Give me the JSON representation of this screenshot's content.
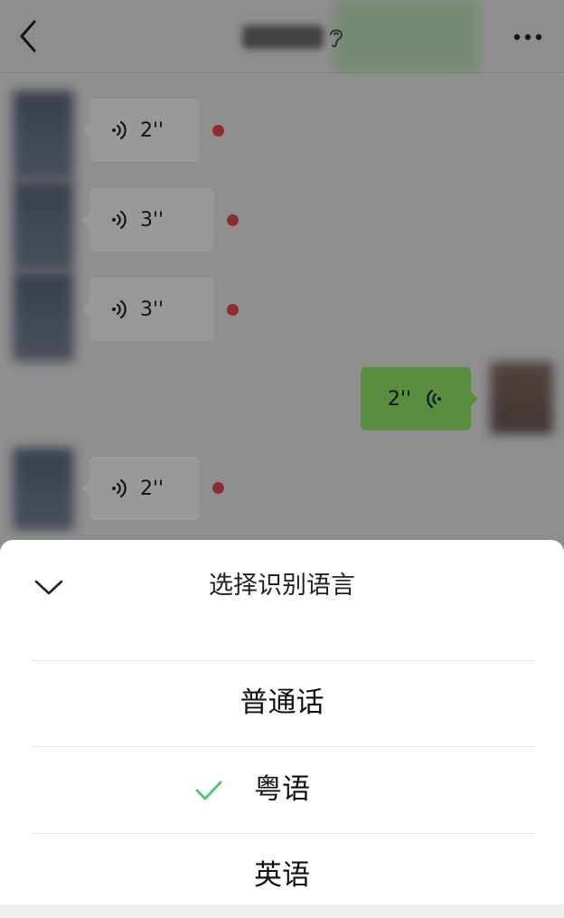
{
  "chat": {
    "messages": [
      {
        "direction": "incoming",
        "duration": "2''",
        "unread": true
      },
      {
        "direction": "incoming",
        "duration": "3''",
        "unread": true
      },
      {
        "direction": "incoming",
        "duration": "3''",
        "unread": true
      },
      {
        "direction": "outgoing",
        "duration": "2''",
        "unread": false
      },
      {
        "direction": "incoming",
        "duration": "2''",
        "unread": true
      }
    ]
  },
  "sheet": {
    "title": "选择识别语言",
    "options": [
      {
        "label": "普通话",
        "selected": false
      },
      {
        "label": "粤语",
        "selected": true
      },
      {
        "label": "英语",
        "selected": false
      }
    ]
  },
  "colors": {
    "accent_green": "#95ec69",
    "check_green": "#4fc77c",
    "unread_red": "#f24a4a",
    "overlay": "rgba(0,0,0,0.40)"
  },
  "icons": {
    "back": "chevron-left-icon",
    "more": "more-dots-icon",
    "ear": "ear-icon",
    "voice": "voice-waves-icon",
    "sheet_close": "chevron-down-icon",
    "check": "check-icon"
  }
}
